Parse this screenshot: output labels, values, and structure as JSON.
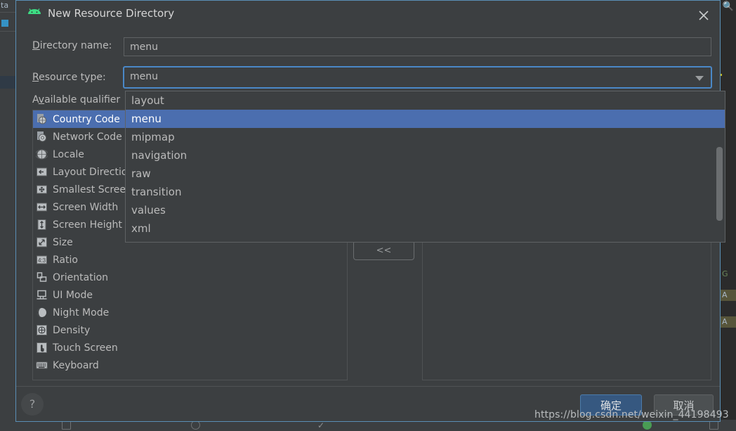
{
  "dialog": {
    "title": "New Resource Directory",
    "title_icon": "android-icon",
    "close_icon": "close-icon"
  },
  "form": {
    "directory_name": {
      "label_prefix": "",
      "label_accel": "D",
      "label_rest": "irectory name:",
      "value": "menu",
      "placeholder": ""
    },
    "resource_type": {
      "label_accel": "R",
      "label_rest": "esource type:",
      "value": "menu",
      "arrow_icon": "chevron-down-icon"
    },
    "available_qualifiers_label": {
      "prefix": "A",
      "accel": "v",
      "rest": "ailable qualifier"
    }
  },
  "dropdown": {
    "open": true,
    "selected": "menu",
    "options": [
      "layout",
      "menu",
      "mipmap",
      "navigation",
      "raw",
      "transition",
      "values",
      "xml"
    ]
  },
  "qualifiers": {
    "selected": "Country Code",
    "items": [
      {
        "label": "Country Code",
        "icon": "country-code-icon"
      },
      {
        "label": "Network Code",
        "icon": "network-code-icon"
      },
      {
        "label": "Locale",
        "icon": "globe-icon"
      },
      {
        "label": "Layout Direction",
        "icon": "arrow-left-icon"
      },
      {
        "label": "Smallest Screen Width",
        "icon": "resize-all-icon"
      },
      {
        "label": "Screen Width",
        "icon": "arrow-horizontal-icon"
      },
      {
        "label": "Screen Height",
        "icon": "arrow-vertical-icon"
      },
      {
        "label": "Size",
        "icon": "diagonal-arrow-icon"
      },
      {
        "label": "Ratio",
        "icon": "ratio-icon"
      },
      {
        "label": "Orientation",
        "icon": "orientation-icon"
      },
      {
        "label": "UI Mode",
        "icon": "ui-mode-icon"
      },
      {
        "label": "Night Mode",
        "icon": "moon-icon"
      },
      {
        "label": "Density",
        "icon": "density-icon"
      },
      {
        "label": "Touch Screen",
        "icon": "touch-icon"
      },
      {
        "label": "Keyboard",
        "icon": "keyboard-icon"
      }
    ]
  },
  "move_button": {
    "label": "<<"
  },
  "chosen_qualifiers": {
    "items": []
  },
  "footer": {
    "help_label": "?",
    "ok_label": "确定",
    "cancel_label": "取消"
  },
  "watermark": {
    "text": "https://blog.csdn.net/weixin_44198493"
  },
  "background": {
    "left_tab_label": "ta",
    "code_lines": [
      {
        "text": "G",
        "highlight": false
      },
      {
        "text": "A",
        "highlight": true
      },
      {
        "text": "A",
        "highlight": true
      }
    ]
  },
  "colors": {
    "dialog_bg": "#3c3f41",
    "dialog_border": "#5a8fb5",
    "accent_blue": "#4b6eaf",
    "focus_blue": "#4a88c7",
    "ok_button": "#365880",
    "text": "#bbbbbb",
    "android_green": "#3ddc84"
  }
}
